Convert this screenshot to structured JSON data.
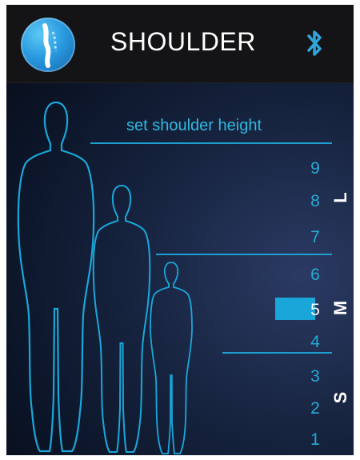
{
  "header": {
    "title": "SHOULDER",
    "logo_icon": "spine-icon",
    "bluetooth_icon": "bluetooth-icon"
  },
  "caption": "set shoulder height",
  "levels": [
    "9",
    "8",
    "7",
    "6",
    "5",
    "4",
    "3",
    "2",
    "1"
  ],
  "selected_level": "5",
  "sizes": {
    "large": "L",
    "medium": "M",
    "small": "S"
  },
  "colors": {
    "accent": "#1aa6d9",
    "outline": "#1d9fd0",
    "text": "#27a9d6"
  }
}
